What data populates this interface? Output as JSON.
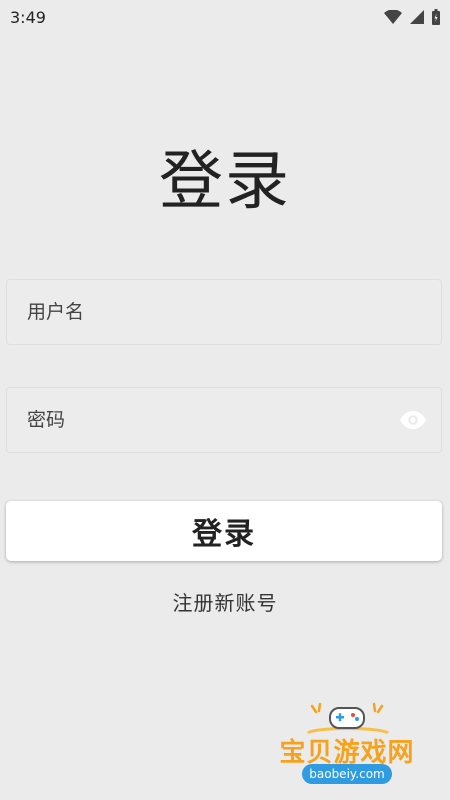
{
  "status_bar": {
    "time": "3:49",
    "icons": [
      "wifi-icon",
      "signal-icon",
      "battery-icon"
    ]
  },
  "title": "登录",
  "username": {
    "placeholder": "用户名",
    "value": ""
  },
  "password": {
    "placeholder": "密码",
    "value": "",
    "toggle_icon": "eye-icon"
  },
  "login_button_label": "登录",
  "register_link": "注册新账号",
  "watermark": {
    "name": "宝贝游戏网",
    "url": "baobeiy.com",
    "logo_icon": "gamepad-icon"
  },
  "colors": {
    "background": "#ebebeb",
    "button_bg": "#ffffff",
    "watermark_orange": "#f6a21c",
    "watermark_blue": "#2f9be0"
  }
}
